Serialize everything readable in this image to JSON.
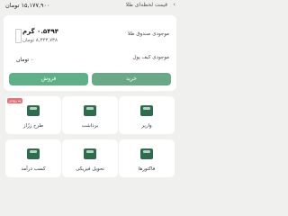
{
  "header": {
    "price_label": "قیمت لحظه‌ای طلا",
    "price_value": "۱۵,۱۷۷,۹۰۰ تومان"
  },
  "account": {
    "gold_label": "موجودی صندوق طلا",
    "gold_amount": "۰.۵۴۹۴ گرم",
    "gold_value_toman": "۸,۳۴۳,۷۳۸ تومان",
    "wallet_label": "موجودی کیف پول",
    "wallet_amount": "۰ تومان"
  },
  "actions": {
    "buy_label": "خرید",
    "sell_label": "فروش"
  },
  "services": [
    {
      "label": "واریز"
    },
    {
      "label": "برداشت"
    },
    {
      "label": "طرح زرّاز",
      "badge": "به زودی"
    },
    {
      "label": "فاکتورها"
    },
    {
      "label": "تحویل فیزیکی"
    },
    {
      "label": "کسب درآمد"
    }
  ],
  "colors": {
    "primary_green": "#5fb086",
    "dark_green": "#2f6b4f",
    "badge_red": "#e57373"
  }
}
